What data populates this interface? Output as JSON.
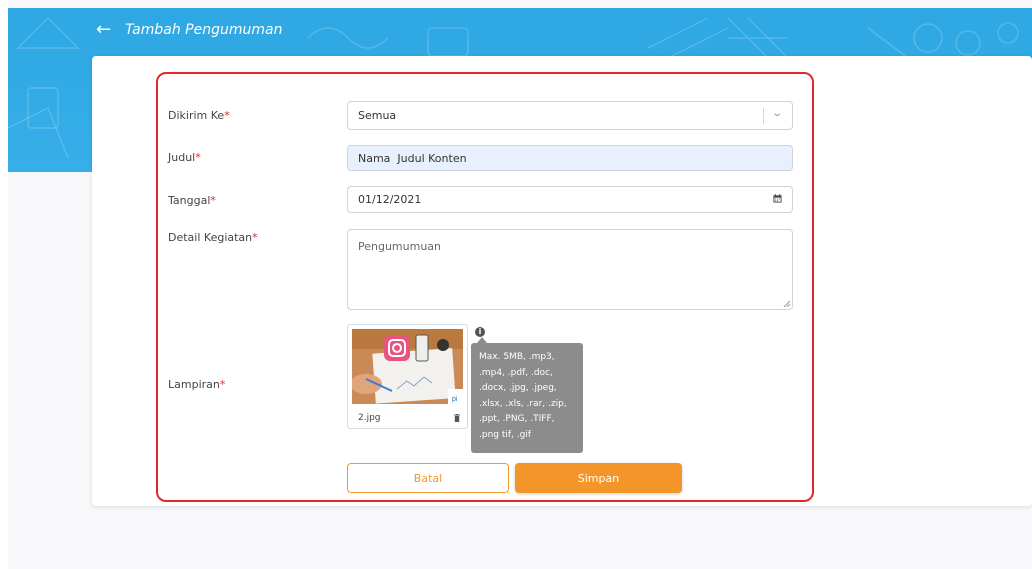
{
  "header": {
    "title": "Tambah Pengumuman",
    "back_icon": "arrow-left-icon"
  },
  "form": {
    "recipient": {
      "label": "Dikirim Ke",
      "required_mark": "*",
      "value": "Semua"
    },
    "title": {
      "label": "Judul",
      "required_mark": "*",
      "value": "Nama  Judul Konten"
    },
    "date": {
      "label": "Tanggal",
      "required_mark": "*",
      "value": "01/12/2021"
    },
    "detail": {
      "label": "Detail Kegiatan",
      "required_mark": "*",
      "placeholder": "Pengumumuan"
    },
    "attachment": {
      "label": "Lampiran",
      "required_mark": "*",
      "file_name": "2.jpg",
      "info_icon": "i",
      "tooltip": "Max. 5MB, .mp3, .mp4, .pdf, .doc, .docx, .jpg, .jpeg, .xlsx, .xls, .rar, .zip, .ppt, .PNG, .TIFF, .png tif, .gif"
    }
  },
  "actions": {
    "cancel_label": "Batal",
    "save_label": "Simpan"
  },
  "colors": {
    "banner": "#2ea7e3",
    "required": "#e0282e",
    "accent": "#f4952a",
    "tooltip_bg": "#8c8c8c"
  }
}
